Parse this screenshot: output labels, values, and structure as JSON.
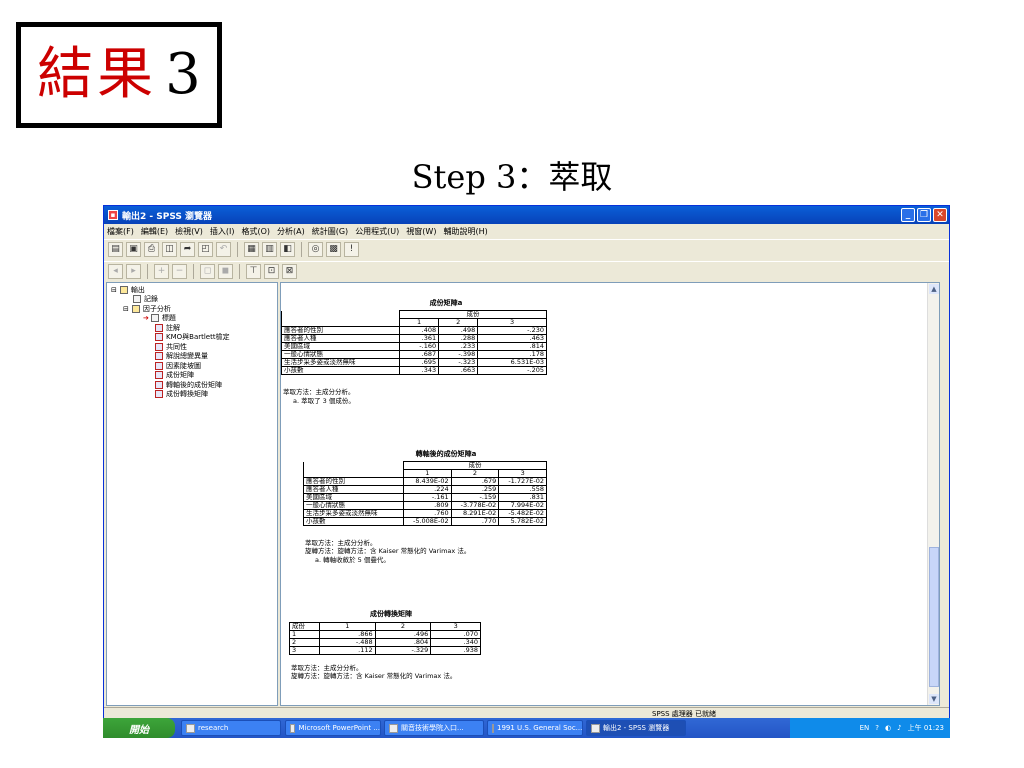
{
  "slide": {
    "title_cn": "結果",
    "title_num": "3",
    "step_title": "Step 3：萃取"
  },
  "window": {
    "title": "輸出2 - SPSS 瀏覽器",
    "menu": [
      "檔案(F)",
      "編輯(E)",
      "檢視(V)",
      "插入(I)",
      "格式(O)",
      "分析(A)",
      "統計圖(G)",
      "公用程式(U)",
      "視窗(W)",
      "輔助說明(H)"
    ]
  },
  "tree": {
    "items": [
      "輸出",
      "記錄",
      "因子分析",
      "標題",
      "註解",
      "KMO與Bartlett檢定",
      "共同性",
      "解說總變異量",
      "因素陡坡圖",
      "成份矩陣",
      "轉軸後的成份矩陣",
      "成份轉換矩陣"
    ]
  },
  "component_matrix": {
    "title": "成份矩陣a",
    "header_group": "成份",
    "cols": [
      "1",
      "2",
      "3"
    ],
    "rows": [
      {
        "label": "應答者的性別",
        "values": [
          ".408",
          ".498",
          "-.230"
        ]
      },
      {
        "label": "應答者人種",
        "values": [
          ".361",
          ".288",
          ".463"
        ]
      },
      {
        "label": "美國區域",
        "values": [
          "-.160",
          ".233",
          ".814"
        ]
      },
      {
        "label": "一般心情狀態",
        "values": [
          ".687",
          "-.398",
          ".178"
        ]
      },
      {
        "label": "生活步采多姿或淡然無味",
        "values": [
          ".695",
          "-.323",
          "6.531E-03"
        ]
      },
      {
        "label": "小孩數",
        "values": [
          ".343",
          ".663",
          "-.205"
        ]
      }
    ],
    "foot1": "萃取方法：主成分分析。",
    "foot2": "a. 萃取了 3 個成份。"
  },
  "rotated_matrix": {
    "title": "轉軸後的成份矩陣a",
    "header_group": "成份",
    "cols": [
      "1",
      "2",
      "3"
    ],
    "rows": [
      {
        "label": "應答者的性別",
        "values": [
          "8.439E-02",
          ".679",
          "-1.727E-02"
        ]
      },
      {
        "label": "應答者人種",
        "values": [
          ".224",
          ".259",
          ".558"
        ]
      },
      {
        "label": "美國區域",
        "values": [
          "-.161",
          "-.159",
          ".831"
        ]
      },
      {
        "label": "一般心情狀態",
        "values": [
          ".809",
          "-3.778E-02",
          "7.994E-02"
        ]
      },
      {
        "label": "生活步采多姿或淡然無味",
        "values": [
          ".760",
          "8.291E-02",
          "-5.482E-02"
        ]
      },
      {
        "label": "小孩數",
        "values": [
          "-5.008E-02",
          ".770",
          "5.782E-02"
        ]
      }
    ],
    "foot1": "萃取方法：主成分分析。",
    "foot2": "旋轉方法：旋轉方法：含 Kaiser 常態化的 Varimax 法。",
    "foot3": "a. 轉軸收斂於 5 個疊代。"
  },
  "transform_matrix": {
    "title": "成份轉換矩陣",
    "header": [
      "成份",
      "1",
      "2",
      "3"
    ],
    "rows": [
      {
        "label": "1",
        "values": [
          ".866",
          ".496",
          ".070"
        ]
      },
      {
        "label": "2",
        "values": [
          "-.488",
          ".804",
          ".340"
        ]
      },
      {
        "label": "3",
        "values": [
          ".112",
          "-.329",
          ".938"
        ]
      }
    ],
    "foot1": "萃取方法：主成分分析。",
    "foot2": "旋轉方法：旋轉方法：含 Kaiser 常態化的 Varimax 法。"
  },
  "status": "SPSS 處理器 已就緒",
  "taskbar": {
    "start": "開始",
    "tasks": [
      "research",
      "Microsoft PowerPoint ...",
      "關音技術學院入口...",
      "1991 U.S. General Soc...",
      "輸出2 - SPSS 瀏覽器"
    ],
    "lang": "EN",
    "clock": "上午 01:23"
  }
}
